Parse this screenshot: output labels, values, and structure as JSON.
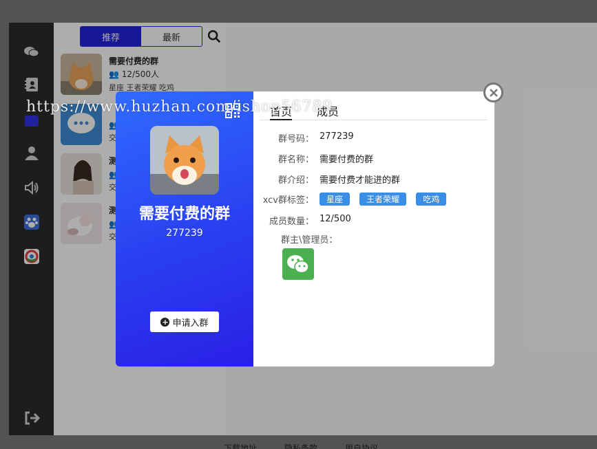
{
  "list": {
    "tabs": [
      "推荐",
      "最新"
    ],
    "items": [
      {
        "name": "需要付费的群",
        "count": "12/500人",
        "tags": "星座 王者荣耀 吃鸡"
      },
      {
        "name": "",
        "count": "",
        "tags": "交"
      },
      {
        "name": "测",
        "count": "",
        "tags": "交"
      },
      {
        "name": "测",
        "count": "",
        "tags": "交"
      }
    ]
  },
  "modal": {
    "group_name": "需要付费的群",
    "group_id": "277239",
    "apply_label": "申请入群",
    "tabs": [
      "首页",
      "成员"
    ],
    "fields": [
      {
        "label": "群号码：",
        "value": "277239"
      },
      {
        "label": "群名称：",
        "value": "需要付费的群"
      },
      {
        "label": "群介绍：",
        "value": "需要付费才能进的群"
      },
      {
        "label": "xcv群标签：",
        "value": ""
      },
      {
        "label": "成员数量：",
        "value": "12/500"
      }
    ],
    "tags": [
      "星座",
      "王者荣耀",
      "吃鸡"
    ],
    "admin_label": "群主\\管理员："
  },
  "watermark": "https://www.huzhan.com/ishop56789",
  "footer": [
    "下载地址",
    "隐私条款",
    "用户协议"
  ],
  "colors": {
    "accent": "#2222dd",
    "tag": "#3a8ee6",
    "modal_gradient": "#2f6bff"
  }
}
